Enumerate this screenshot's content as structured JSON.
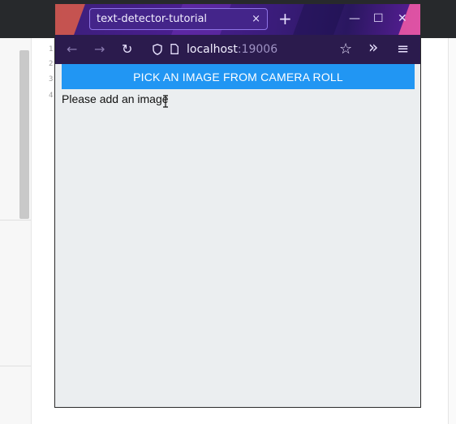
{
  "editor": {
    "line_numbers": [
      "1",
      "2",
      "3",
      "4"
    ]
  },
  "browser": {
    "tab_title": "text-detector-tutorial",
    "tab_close": "×",
    "new_tab": "+",
    "url_host": "localhost",
    "url_port": ":19006",
    "window_controls": {
      "minimize": "—",
      "maximize": "☐",
      "close": "✕"
    },
    "nav": {
      "back": "←",
      "forward": "→",
      "reload": "↻",
      "bookmark": "☆",
      "overflow": "»",
      "menu": "≡"
    }
  },
  "app": {
    "pick_button_label": "PICK AN IMAGE FROM CAMERA ROLL",
    "status_message": "Please add an image"
  },
  "colors": {
    "accent_button": "#2196f3",
    "titlebar": "#3b1f7a",
    "navbar": "#2b1b4d",
    "page_background": "#ebeef0"
  }
}
